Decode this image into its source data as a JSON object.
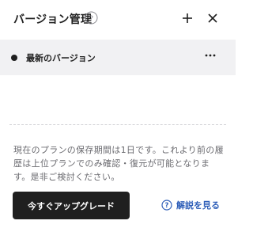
{
  "header": {
    "title": "バージョン管理",
    "help_icon": "help-circle-icon",
    "add_icon": "plus-icon",
    "close_icon": "close-icon"
  },
  "versions": [
    {
      "label": "最新のバージョン",
      "menu_icon": "more-horizontal-icon"
    }
  ],
  "notice": {
    "text": "現在のプランの保存期間は1日です。これより前の履歴は上位プランでのみ確認・復元が可能となります。是非ご検討ください。"
  },
  "actions": {
    "upgrade_label": "今すぐアップグレード",
    "explain_label": "解説を見る",
    "explain_icon": "help-circle-icon"
  },
  "colors": {
    "text_primary": "#1f1f1f",
    "text_secondary": "#6b6b70",
    "row_highlight": "#f1f1f3",
    "button_dark": "#1f1f1f",
    "link_blue": "#2f5fb9"
  }
}
